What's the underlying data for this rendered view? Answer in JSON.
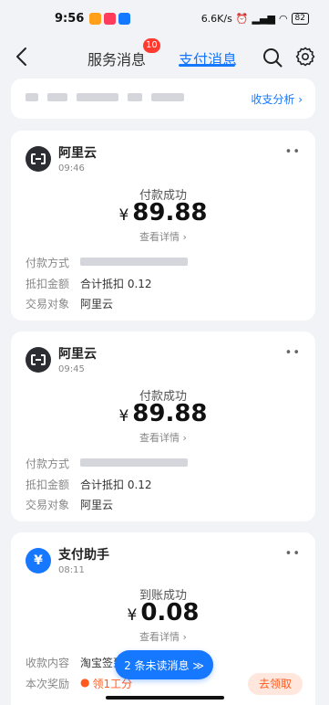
{
  "status_bar": {
    "time": "9:56",
    "network_speed": "6.6K/s",
    "battery": "82"
  },
  "header": {
    "tabs": [
      {
        "label": "服务消息",
        "badge": "10"
      },
      {
        "label": "支付消息",
        "active": true
      }
    ],
    "icons": [
      "back-icon",
      "search-icon",
      "gear-icon"
    ]
  },
  "summary": {
    "link_label": "收支分析 ›"
  },
  "messages": [
    {
      "sender": "阿里云",
      "time": "09:46",
      "status": "付款成功",
      "currency": "¥",
      "amount": "89.88",
      "detail_link": "查看详情 ›",
      "rows": [
        {
          "key": "付款方式",
          "value": ""
        },
        {
          "key": "抵扣金额",
          "value": "合计抵扣 0.12"
        },
        {
          "key": "交易对象",
          "value": "阿里云"
        }
      ]
    },
    {
      "sender": "阿里云",
      "time": "09:45",
      "status": "付款成功",
      "currency": "¥",
      "amount": "89.88",
      "detail_link": "查看详情 ›",
      "rows": [
        {
          "key": "付款方式",
          "value": ""
        },
        {
          "key": "抵扣金额",
          "value": "合计抵扣 0.12"
        },
        {
          "key": "交易对象",
          "value": "阿里云"
        }
      ]
    },
    {
      "sender": "支付助手",
      "time": "08:11",
      "status": "到账成功",
      "currency": "¥",
      "amount": "0.08",
      "detail_link": "查看详情 ›",
      "rows": [
        {
          "key": "收款内容",
          "value": "淘宝签到"
        },
        {
          "key": "本次奖励",
          "value": "领1工分"
        }
      ],
      "action_label": "去领取"
    }
  ],
  "floating": {
    "unread_label": "2 条未读消息 ≫"
  },
  "colors": {
    "accent": "#1677ff",
    "badge": "#ff3b30",
    "claim": "#ff5a1f"
  }
}
